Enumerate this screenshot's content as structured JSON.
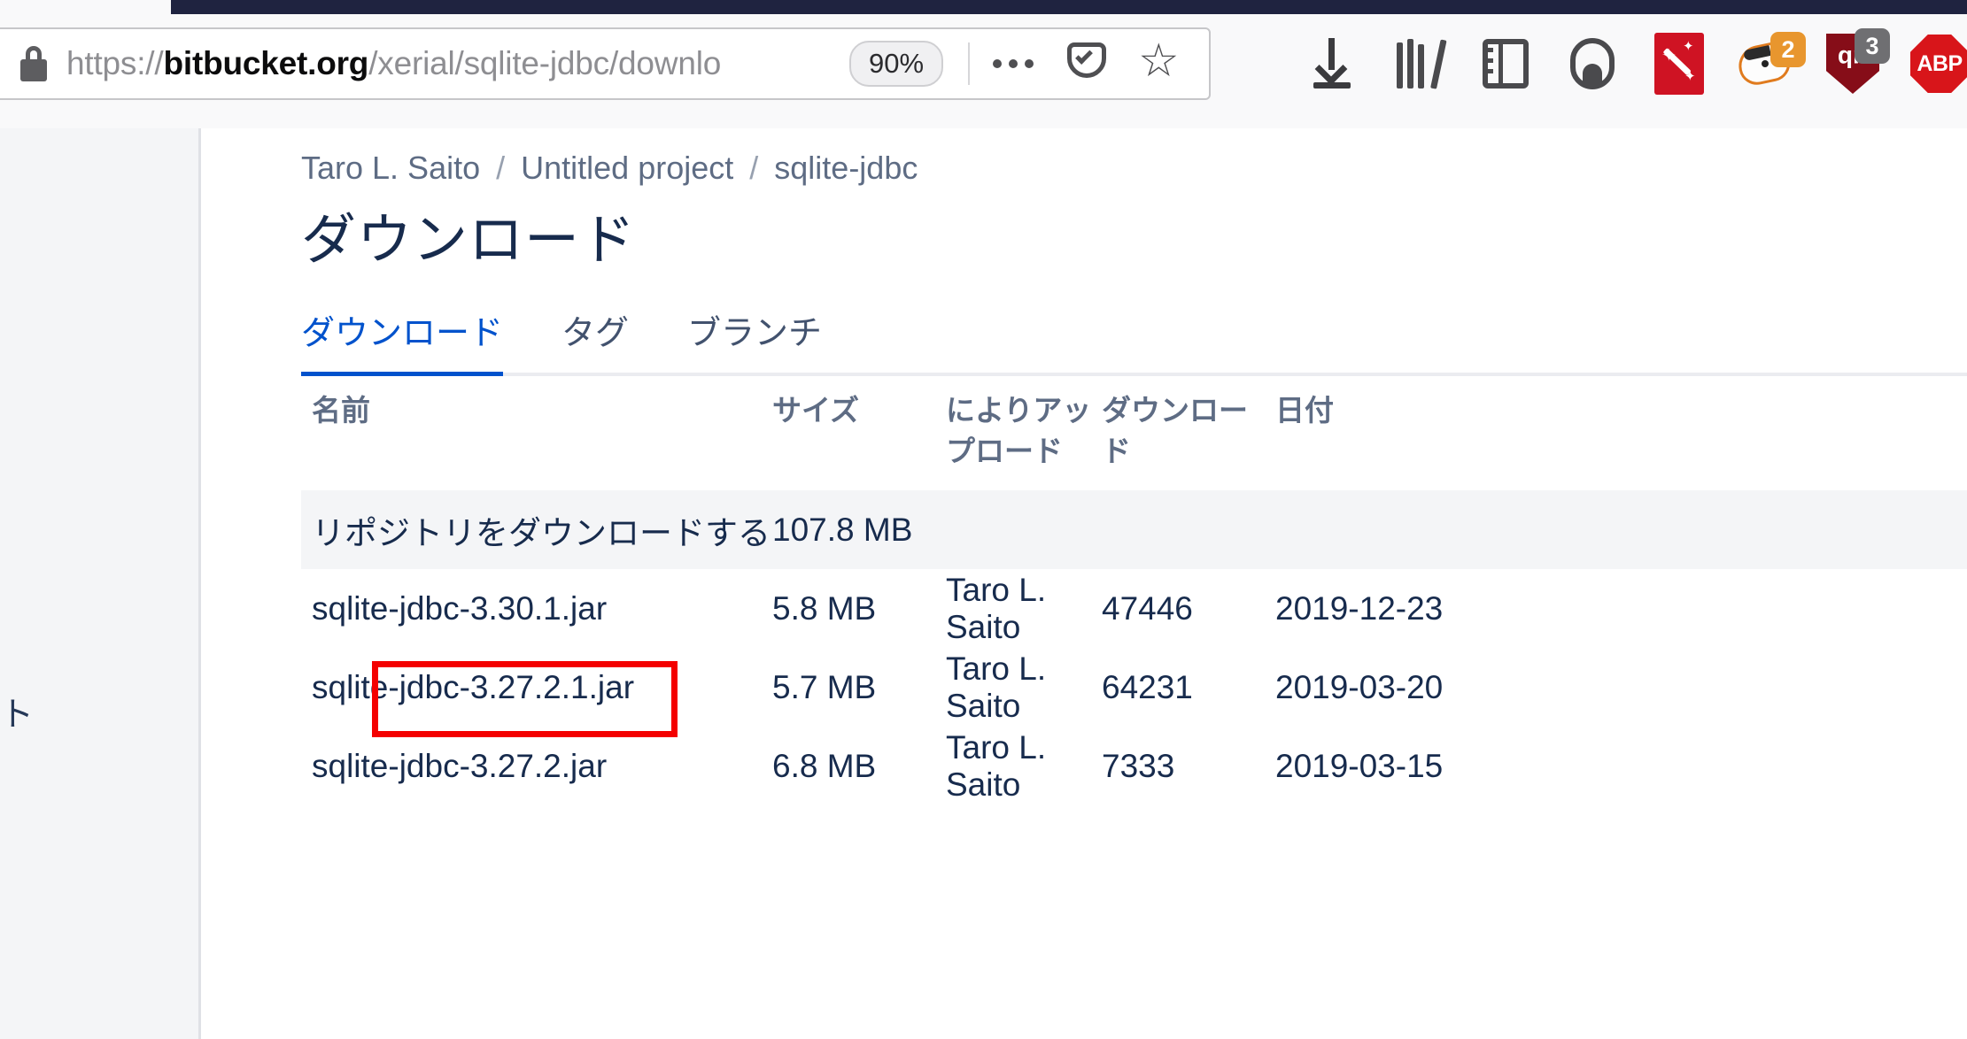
{
  "browser": {
    "url_scheme": "https://",
    "url_domain": "bitbucket.org",
    "url_path": "/xerial/sqlite-jdbc/downlo",
    "zoom_level": "90%",
    "lock_icon": "lock-icon",
    "toolbar_icons": [
      {
        "name": "downloads-icon",
        "badge": ""
      },
      {
        "name": "library-icon",
        "badge": ""
      },
      {
        "name": "sidebar-icon",
        "badge": ""
      },
      {
        "name": "account-icon",
        "badge": ""
      },
      {
        "name": "magic-wand-extension-icon",
        "badge": ""
      },
      {
        "name": "privacy-badger-extension-icon",
        "badge": "2"
      },
      {
        "name": "ublock-origin-extension-icon",
        "badge": "3"
      },
      {
        "name": "adblock-plus-extension-icon",
        "badge": "ABP"
      }
    ],
    "badge_privacy_badger": "2",
    "badge_ublock": "3",
    "abp_label": "ABP"
  },
  "sidebar": {
    "clipped_text": "ト"
  },
  "breadcrumb": {
    "workspace": "Taro L. Saito",
    "project": "Untitled project",
    "repo": "sqlite-jdbc",
    "separator": "/"
  },
  "page_title": "ダウンロード",
  "tabs": [
    {
      "label": "ダウンロード",
      "active": true
    },
    {
      "label": "タグ",
      "active": false
    },
    {
      "label": "ブランチ",
      "active": false
    }
  ],
  "table": {
    "headers": {
      "name": "名前",
      "size": "サイズ",
      "uploaded_by": "によりアップロード",
      "downloads": "ダウンロード",
      "date": "日付"
    },
    "rows": [
      {
        "name": "リポジトリをダウンロードする",
        "size": "107.8 MB",
        "uploaded_by": "",
        "downloads": "",
        "date": "",
        "shaded": true,
        "highlighted": false
      },
      {
        "name": "sqlite-jdbc-3.30.1.jar",
        "size": "5.8 MB",
        "uploaded_by": "Taro L. Saito",
        "downloads": "47446",
        "date": "2019-12-23",
        "shaded": false,
        "highlighted": true
      },
      {
        "name": "sqlite-jdbc-3.27.2.1.jar",
        "size": "5.7 MB",
        "uploaded_by": "Taro L. Saito",
        "downloads": "64231",
        "date": "2019-03-20",
        "shaded": false,
        "highlighted": false
      },
      {
        "name": "sqlite-jdbc-3.27.2.jar",
        "size": "6.8 MB",
        "uploaded_by": "Taro L. Saito",
        "downloads": "7333",
        "date": "2019-03-15",
        "shaded": false,
        "highlighted": false
      }
    ]
  },
  "colors": {
    "accent_blue": "#0052CC",
    "title_navy": "#172B4D",
    "muted": "#5E6C84",
    "annotation_red": "#F40000",
    "topbar_navy": "#1F2340",
    "sidebar_gray": "#F4F5F7"
  }
}
